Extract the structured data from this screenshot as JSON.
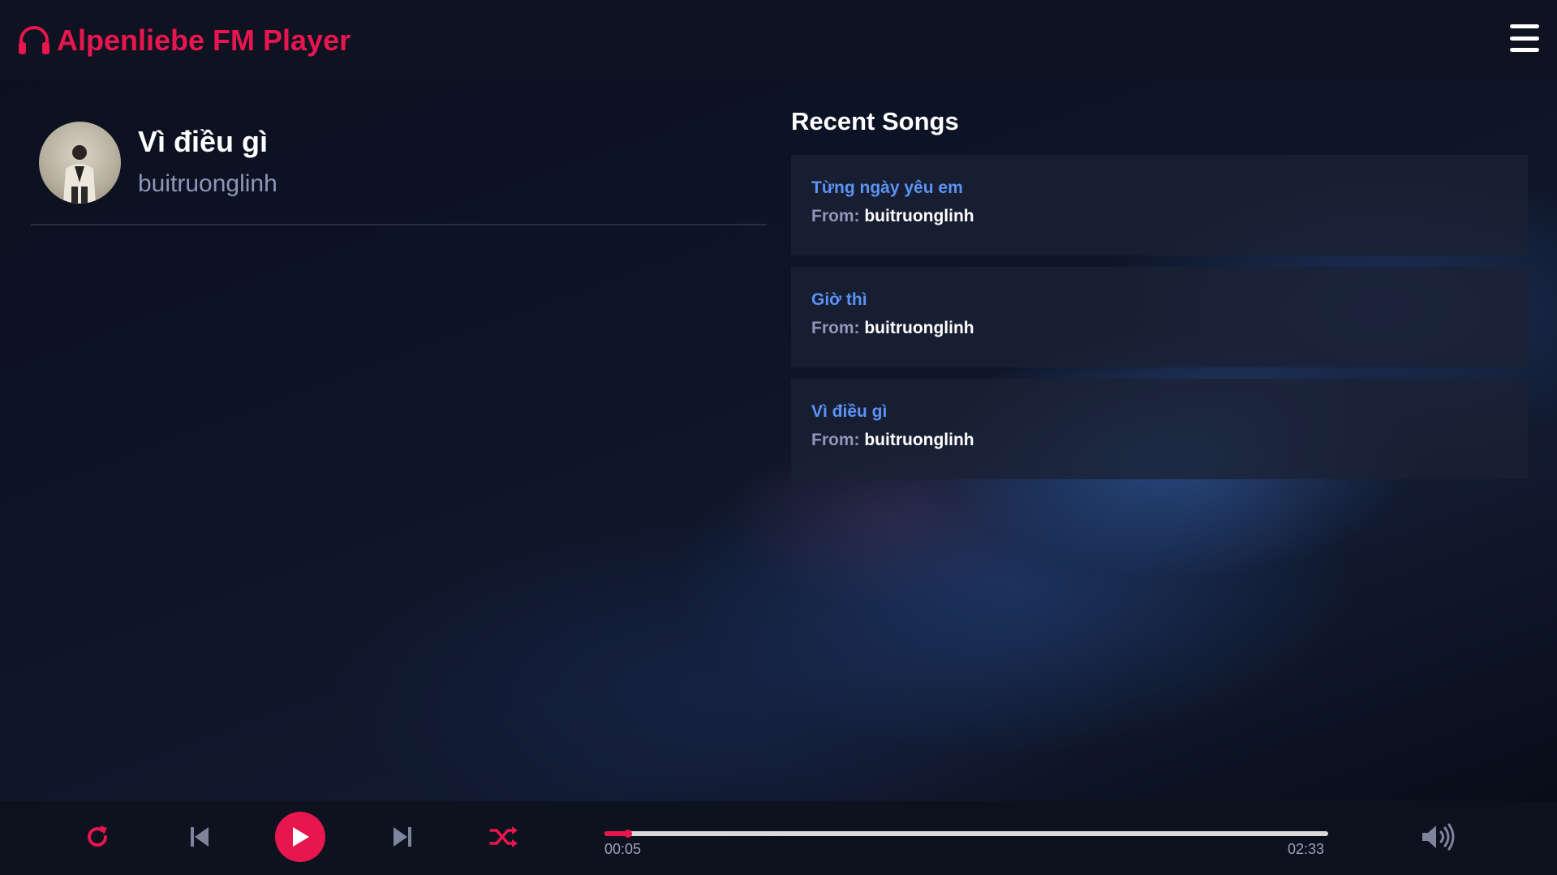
{
  "app": {
    "title": "Alpenliebe FM Player",
    "accent_color": "#e8164f",
    "link_color": "#5b93f5"
  },
  "header": {
    "logo_icon": "headphones-icon",
    "menu_icon": "hamburger-menu-icon"
  },
  "now_playing": {
    "title": "Vì điều gì",
    "artist": "buitruonglinh",
    "avatar_icon": "album-cover-avatar"
  },
  "recent": {
    "heading": "Recent Songs",
    "from_label": "From:",
    "songs": [
      {
        "title": "Từng ngày yêu em",
        "from": "buitruonglinh"
      },
      {
        "title": "Giờ thì",
        "from": "buitruonglinh"
      },
      {
        "title": "Vì điều gì",
        "from": "buitruonglinh"
      }
    ]
  },
  "player": {
    "repeat_icon": "repeat-icon",
    "prev_icon": "skip-previous-icon",
    "play_icon": "play-icon",
    "next_icon": "skip-next-icon",
    "shuffle_icon": "shuffle-icon",
    "volume_icon": "volume-icon",
    "current_time": "00:05",
    "duration": "02:33",
    "progress_fraction": 0.033
  }
}
